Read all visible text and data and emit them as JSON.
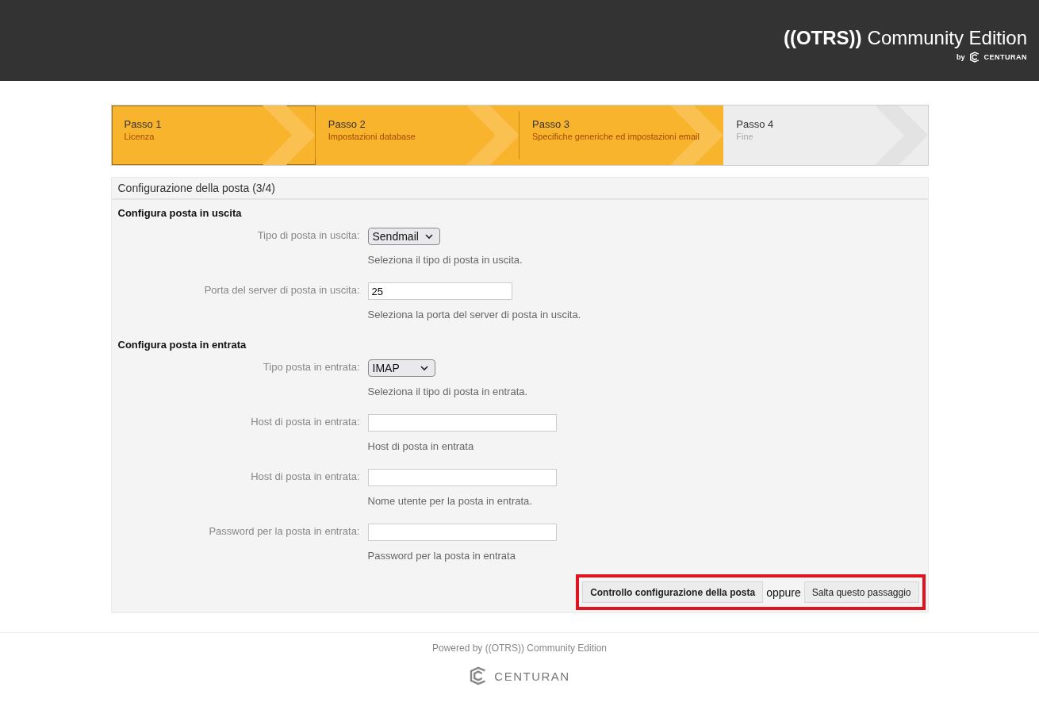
{
  "header": {
    "brand": "((OTRS))",
    "product": "Community Edition",
    "by": "by",
    "company": "CENTURAN"
  },
  "steps": [
    {
      "title": "Passo 1",
      "subtitle": "Licenza",
      "done": true
    },
    {
      "title": "Passo 2",
      "subtitle": "Impostazioni database",
      "done": true
    },
    {
      "title": "Passo 3",
      "subtitle": "Specifiche generiche ed impostazioni email",
      "done": true
    },
    {
      "title": "Passo 4",
      "subtitle": "Fine",
      "done": false
    }
  ],
  "panel": {
    "title": "Configurazione della posta (3/4)",
    "sections": [
      {
        "heading": "Configura posta in uscita",
        "fields": [
          {
            "kind": "select",
            "label": "Tipo di posta in uscita:",
            "value": "Sendmail",
            "hint": "Seleziona il tipo di posta in uscita."
          },
          {
            "kind": "number",
            "label": "Porta del server di posta in uscita:",
            "value": "25",
            "hint": "Seleziona la porta del server di posta in uscita."
          }
        ]
      },
      {
        "heading": "Configura posta in entrata",
        "fields": [
          {
            "kind": "select",
            "label": "Tipo posta in entrata:",
            "value": "IMAP",
            "hint": "Seleziona il tipo di posta in entrata."
          },
          {
            "kind": "text",
            "label": "Host di posta in entrata:",
            "hint": "Host di posta in entrata"
          },
          {
            "kind": "text",
            "label": "Host di posta in entrata:",
            "hint": "Nome utente per la posta in entrata."
          },
          {
            "kind": "password",
            "label": "Password per la posta in entrata:",
            "hint": "Password per la posta in entrata"
          }
        ]
      }
    ]
  },
  "actions": {
    "highlighted": true,
    "primary": "Controllo configurazione della posta",
    "separator": "oppure",
    "secondary": "Salta questo passaggio"
  },
  "footer": {
    "powered": "Powered by ((OTRS)) Community Edition",
    "company": "CENTURAN"
  }
}
